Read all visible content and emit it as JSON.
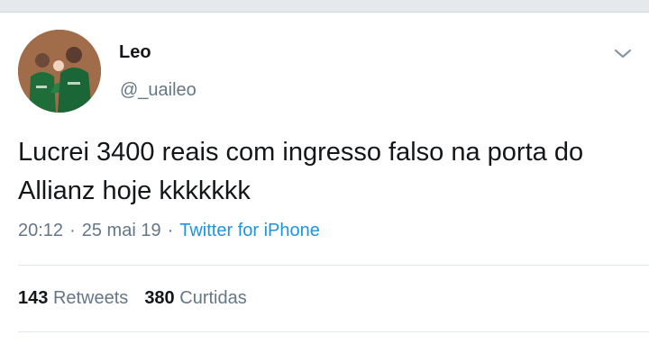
{
  "tweet": {
    "author_name": "Leo",
    "author_handle": "@_uaileo",
    "text": "Lucrei 3400 reais com ingresso falso na porta do Allianz hoje kkkkkkk",
    "time": "20:12",
    "date": "25 mai 19",
    "source": "Twitter for iPhone",
    "separator": "·"
  },
  "stats": {
    "retweets_count": "143",
    "retweets_label": "Retweets",
    "likes_count": "380",
    "likes_label": "Curtidas"
  },
  "icons": {
    "menu": "chevron-down-icon"
  },
  "colors": {
    "text": "#14171a",
    "muted": "#657786",
    "link": "#1b95e0",
    "divider": "#e1e8ed"
  }
}
